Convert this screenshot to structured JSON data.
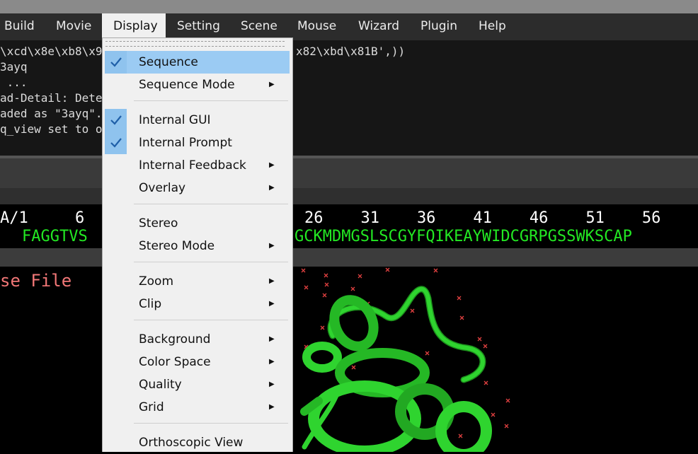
{
  "menubar": {
    "items": [
      {
        "label": "Build",
        "active": false
      },
      {
        "label": "Movie",
        "active": false
      },
      {
        "label": "Display",
        "active": true
      },
      {
        "label": "Setting",
        "active": false
      },
      {
        "label": "Scene",
        "active": false
      },
      {
        "label": "Mouse",
        "active": false
      },
      {
        "label": "Wizard",
        "active": false
      },
      {
        "label": "Plugin",
        "active": false
      },
      {
        "label": "Help",
        "active": false
      }
    ]
  },
  "console": {
    "lines": [
      "\\xcd\\x8e\\xb8\\x9",
      "3ayq",
      " ...",
      "ad-Detail: Dete",
      "aded as \"3ayq\".",
      "q_view set to o"
    ],
    "line1_tail": "x82\\xbd\\x81B',))"
  },
  "sequence": {
    "numbers_left": "A/1     6",
    "numbers_right": "26    31    36    41    46    51    56",
    "residues_left": "FAGGTVS",
    "residues_right": "GCKMDMGSLSCGYFQIKEAYWIDCGRPGSSWKSCAP"
  },
  "viewer": {
    "prompt_text": "se File"
  },
  "dropdown": {
    "items": [
      {
        "label": "Sequence",
        "checked": true,
        "submenu": false,
        "highlighted": true
      },
      {
        "label": "Sequence Mode",
        "checked": false,
        "submenu": true,
        "highlighted": false
      },
      {
        "label": "Internal GUI",
        "checked": true,
        "submenu": false,
        "highlighted": false
      },
      {
        "label": "Internal Prompt",
        "checked": true,
        "submenu": false,
        "highlighted": false
      },
      {
        "label": "Internal Feedback",
        "checked": false,
        "submenu": true,
        "highlighted": false
      },
      {
        "label": "Overlay",
        "checked": false,
        "submenu": true,
        "highlighted": false
      },
      {
        "label": "Stereo",
        "checked": false,
        "submenu": false,
        "highlighted": false
      },
      {
        "label": "Stereo Mode",
        "checked": false,
        "submenu": true,
        "highlighted": false
      },
      {
        "label": "Zoom",
        "checked": false,
        "submenu": true,
        "highlighted": false
      },
      {
        "label": "Clip",
        "checked": false,
        "submenu": true,
        "highlighted": false
      },
      {
        "label": "Background",
        "checked": false,
        "submenu": true,
        "highlighted": false
      },
      {
        "label": "Color Space",
        "checked": false,
        "submenu": true,
        "highlighted": false
      },
      {
        "label": "Quality",
        "checked": false,
        "submenu": true,
        "highlighted": false
      },
      {
        "label": "Grid",
        "checked": false,
        "submenu": true,
        "highlighted": false
      },
      {
        "label": "Orthoscopic View",
        "checked": false,
        "submenu": false,
        "highlighted": false
      }
    ]
  },
  "colors": {
    "menubar_bg": "#2c2c2c",
    "menu_highlight": "#9bcbf3",
    "checkmark": "#1f5fa8",
    "sequence_residues": "#23e823",
    "prompt_text": "#f27777",
    "protein_cartoon": "#2fd42f",
    "solvent_marks": "#e04040"
  },
  "icons": {
    "check": "check-icon",
    "submenu": "submenu-arrow-icon"
  }
}
